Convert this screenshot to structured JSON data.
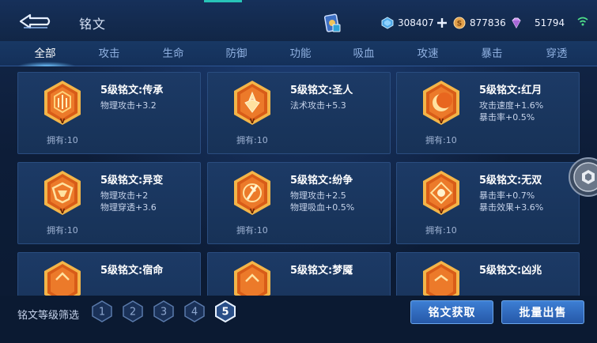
{
  "header": {
    "title": "铭文",
    "currencies": [
      {
        "name": "diamond-coupon",
        "value": "308407"
      },
      {
        "name": "gold-coin",
        "value": "877836"
      },
      {
        "name": "gem",
        "value": "51794"
      }
    ]
  },
  "tabs": [
    {
      "label": "全部",
      "active": true
    },
    {
      "label": "攻击",
      "active": false
    },
    {
      "label": "生命",
      "active": false
    },
    {
      "label": "防御",
      "active": false
    },
    {
      "label": "功能",
      "active": false
    },
    {
      "label": "吸血",
      "active": false
    },
    {
      "label": "攻速",
      "active": false
    },
    {
      "label": "暴击",
      "active": false
    },
    {
      "label": "穿透",
      "active": false
    }
  ],
  "runes": [
    {
      "title": "5级铭文:传承",
      "stats": [
        "物理攻击+3.2"
      ],
      "owned": "拥有:10",
      "icon": "chuancheng-rune-icon"
    },
    {
      "title": "5级铭文:圣人",
      "stats": [
        "法术攻击+5.3"
      ],
      "owned": "拥有:10",
      "icon": "shengren-rune-icon"
    },
    {
      "title": "5级铭文:红月",
      "stats": [
        "攻击速度+1.6%",
        "暴击率+0.5%"
      ],
      "owned": "拥有:10",
      "icon": "hongyue-rune-icon"
    },
    {
      "title": "5级铭文:异变",
      "stats": [
        "物理攻击+2",
        "物理穿透+3.6"
      ],
      "owned": "拥有:10",
      "icon": "yibian-rune-icon"
    },
    {
      "title": "5级铭文:纷争",
      "stats": [
        "物理攻击+2.5",
        "物理吸血+0.5%"
      ],
      "owned": "拥有:10",
      "icon": "fenzheng-rune-icon"
    },
    {
      "title": "5级铭文:无双",
      "stats": [
        "暴击率+0.7%",
        "暴击效果+3.6%"
      ],
      "owned": "拥有:10",
      "icon": "wushuang-rune-icon"
    },
    {
      "title": "5级铭文:宿命",
      "stats": [],
      "owned": "",
      "icon": "suming-rune-icon"
    },
    {
      "title": "5级铭文:梦魇",
      "stats": [],
      "owned": "",
      "icon": "mengyan-rune-icon"
    },
    {
      "title": "5级铭文:凶兆",
      "stats": [],
      "owned": "",
      "icon": "xiongzhao-rune-icon"
    }
  ],
  "filter": {
    "label": "铭文等级筛选",
    "levels": [
      "1",
      "2",
      "3",
      "4",
      "5"
    ],
    "selected": "5"
  },
  "actions": {
    "get_label": "铭文获取",
    "sell_label": "批量出售"
  },
  "colors": {
    "accent": "#28c4b8",
    "emblem_orange": "#e56a1c",
    "emblem_gold": "#f4b548",
    "button_blue": "#2f6bc0"
  }
}
